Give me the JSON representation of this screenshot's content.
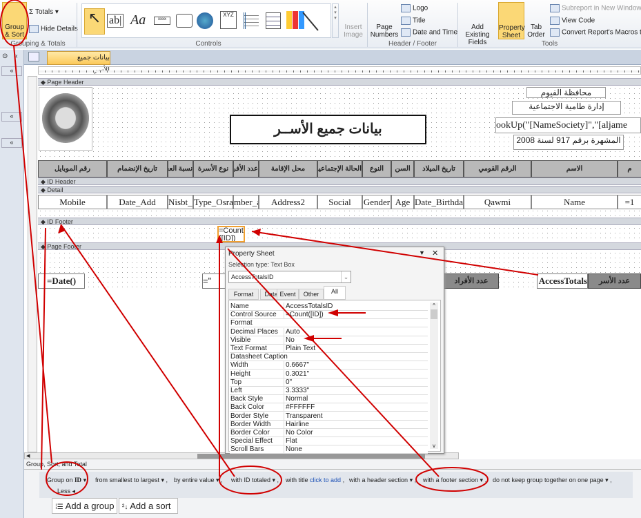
{
  "ribbon": {
    "group_sort": "Group & Sort",
    "totals": "Totals",
    "hide_details": "Hide Details",
    "grouping_label": "Grouping & Totals",
    "controls_label": "Controls",
    "insert_image": "Insert Image",
    "page_numbers": "Page Numbers",
    "logo": "Logo",
    "title": "Title",
    "date_time": "Date and Time",
    "header_footer_label": "Header / Footer",
    "add_existing": "Add Existing Fields",
    "property_sheet": "Property Sheet",
    "tab_order": "Tab Order",
    "subreport": "Subreport in New Window",
    "view_code": "View Code",
    "convert_macros": "Convert Report's Macros to",
    "tools_label": "Tools",
    "control_icons": [
      "pointer-icon",
      "textbox-icon",
      "label-icon",
      "button-icon",
      "tab-control-icon",
      "hyperlink-icon",
      "web-browser-icon",
      "navigation-icon",
      "option-group-icon",
      "chart-icon",
      "line-icon"
    ]
  },
  "document_tab": "بيانات جميع الأسر",
  "sections": {
    "page_header": "Page Header",
    "id_header": "ID Header",
    "detail": "Detail",
    "id_footer": "ID Footer",
    "page_footer": "Page Footer"
  },
  "header": {
    "report_title": "بيانات جميع الأســر",
    "line1": "محافظة الفيوم",
    "line2": "إدارة طامية الاجتماعية",
    "line3": "ookUp(\"[NameSociety]\",\"[aljame",
    "line4": "المشهرة برقم 917 لسنة 2008"
  },
  "columns": [
    {
      "header": "م",
      "field": "=1"
    },
    {
      "header": "الاسم",
      "field": "Name"
    },
    {
      "header": "الرقم القومي",
      "field": "Qawmi"
    },
    {
      "header": "تاريخ الميلاد",
      "field": "Date_Birthday"
    },
    {
      "header": "السن",
      "field": "Age"
    },
    {
      "header": "النوع",
      "field": "Gender"
    },
    {
      "header": "الحالة الإجتماعية",
      "field": "Social"
    },
    {
      "header": "محل الإقامة",
      "field": "Address2"
    },
    {
      "header": "عدد الأفراد",
      "field": "mber_af"
    },
    {
      "header": "نوع الأسرة",
      "field": "Type_Osra"
    },
    {
      "header": "نسبة العجز",
      "field": "Nisbt_Elag"
    },
    {
      "header": "تاريخ الإنضمام",
      "field": "Date_Add"
    },
    {
      "header": "رقم الموبايل",
      "field": "Mobile"
    }
  ],
  "id_footer": {
    "count_box": "=Count([ID])"
  },
  "page_footer": {
    "date": "=Date()",
    "page": "=\"",
    "members_label": "عدد الأفراد",
    "totals_box": "AccessTotals",
    "families_label": "عدد الأسر"
  },
  "property_sheet": {
    "title": "Property Sheet",
    "selection_type": "Selection type:  Text Box",
    "selected": "AccessTotalsID",
    "tabs": [
      "Format",
      "Data",
      "Event",
      "Other",
      "All"
    ],
    "active_tab": "All",
    "rows": [
      [
        "Name",
        "AccessTotalsID"
      ],
      [
        "Control Source",
        "=Count([ID])"
      ],
      [
        "Format",
        ""
      ],
      [
        "Decimal Places",
        "Auto"
      ],
      [
        "Visible",
        "No"
      ],
      [
        "Text Format",
        "Plain Text"
      ],
      [
        "Datasheet Caption",
        ""
      ],
      [
        "Width",
        "0.6667\""
      ],
      [
        "Height",
        "0.3021\""
      ],
      [
        "Top",
        "0\""
      ],
      [
        "Left",
        "3.3333\""
      ],
      [
        "Back Style",
        "Normal"
      ],
      [
        "Back Color",
        "#FFFFFF"
      ],
      [
        "Border Style",
        "Transparent"
      ],
      [
        "Border Width",
        "Hairline"
      ],
      [
        "Border Color",
        "No Color"
      ],
      [
        "Special Effect",
        "Flat"
      ],
      [
        "Scroll Bars",
        "None"
      ]
    ]
  },
  "group_sort": {
    "title": "Group, Sort, and Total",
    "group_on": "Group on",
    "field": "ID",
    "order": "from smallest to largest",
    "by": "by entire value",
    "totaled": "with ID totaled",
    "with_title": "with title",
    "click_to_add": "click to add",
    "header_section": "with a header section",
    "footer_section": "with a footer section",
    "keep_together": "do not keep group together on one page",
    "less": "Less",
    "add_group": "Add a group",
    "add_sort": "Add a sort"
  },
  "annotation_color": "#d00000"
}
